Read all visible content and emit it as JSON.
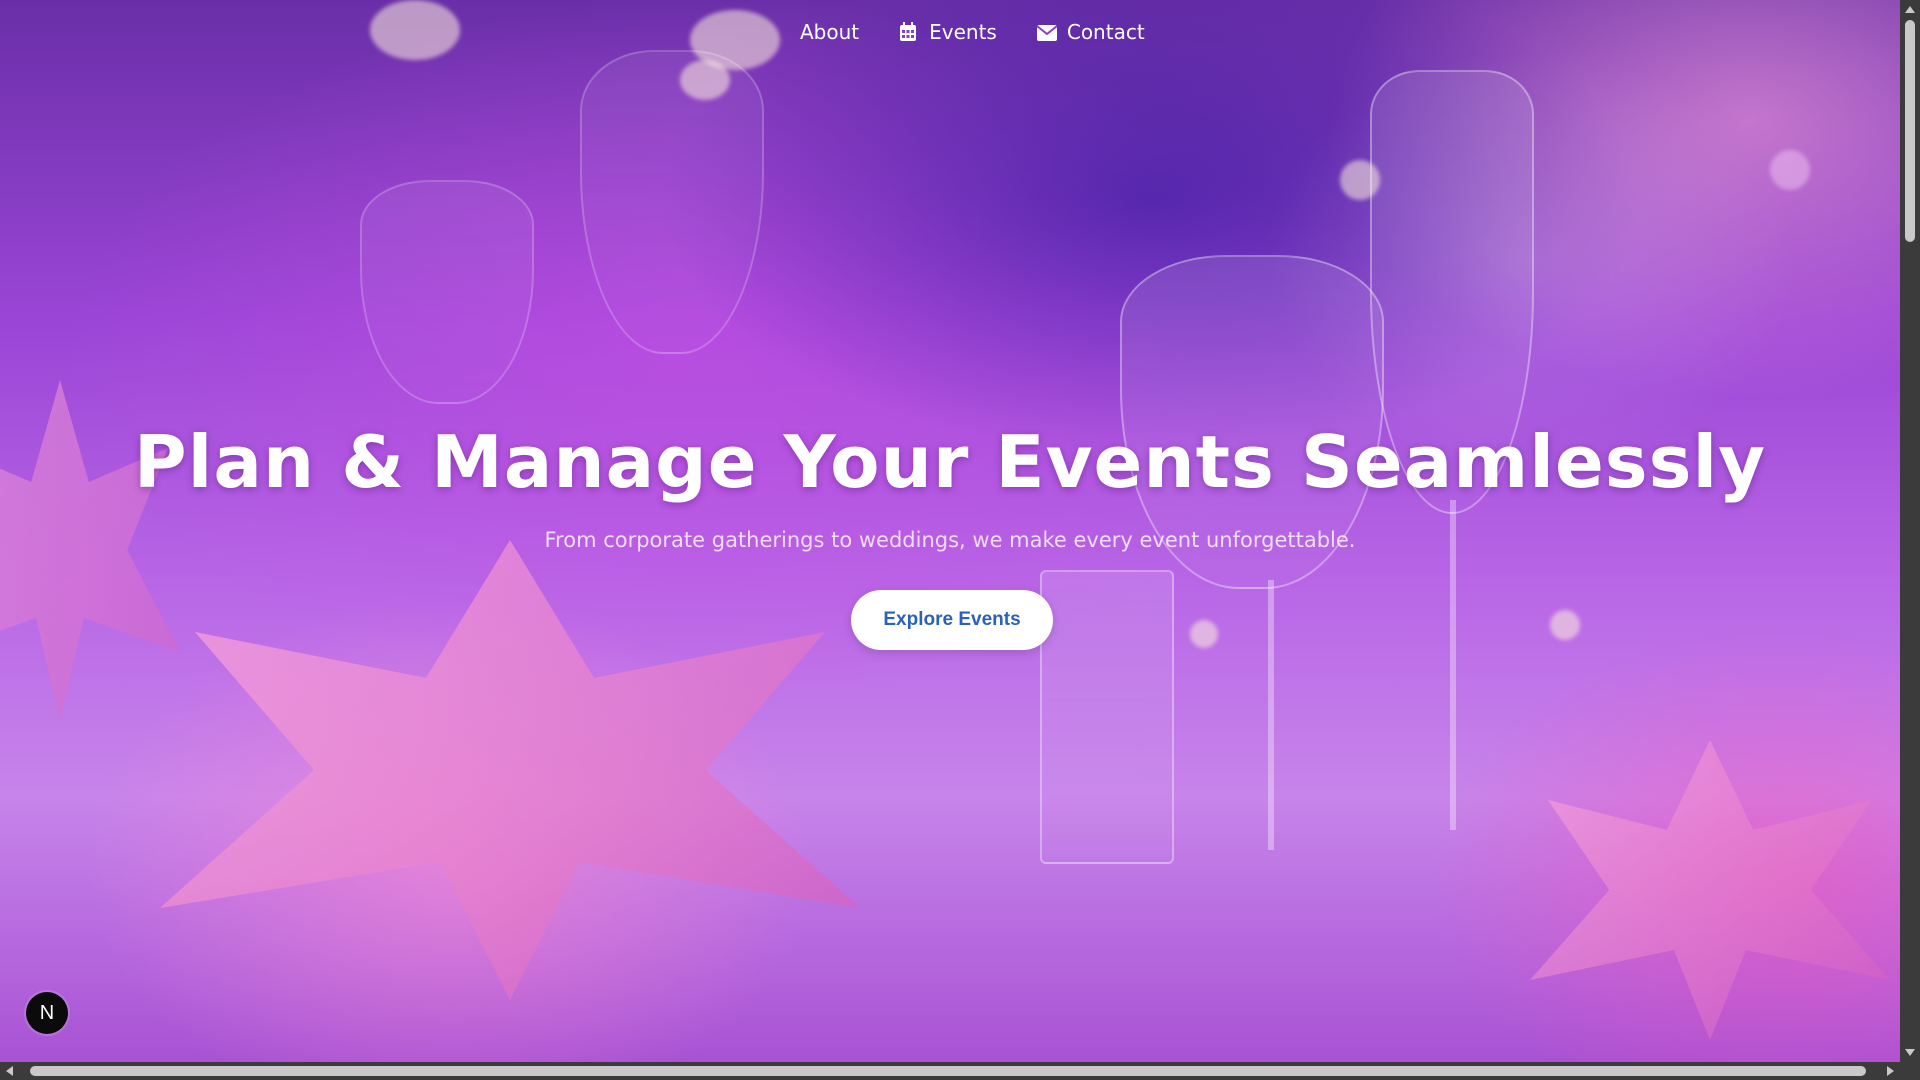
{
  "nav": {
    "items": [
      {
        "label": "About",
        "icon": "info-icon"
      },
      {
        "label": "Events",
        "icon": "calendar-icon"
      },
      {
        "label": "Contact",
        "icon": "envelope-icon"
      }
    ]
  },
  "hero": {
    "title": "Plan & Manage Your Events Seamlessly",
    "subtitle": "From corporate gatherings to weddings, we make every event unforgettable.",
    "cta_label": "Explore Events",
    "background": "event-table-setting-photo"
  },
  "badge": {
    "letter": "N",
    "icon": "nextjs-icon"
  },
  "colors": {
    "cta_text": "#2b62b8",
    "cta_bg": "#ffffff",
    "nav_text": "#ffffff",
    "accent_purple": "#9a45d6"
  }
}
